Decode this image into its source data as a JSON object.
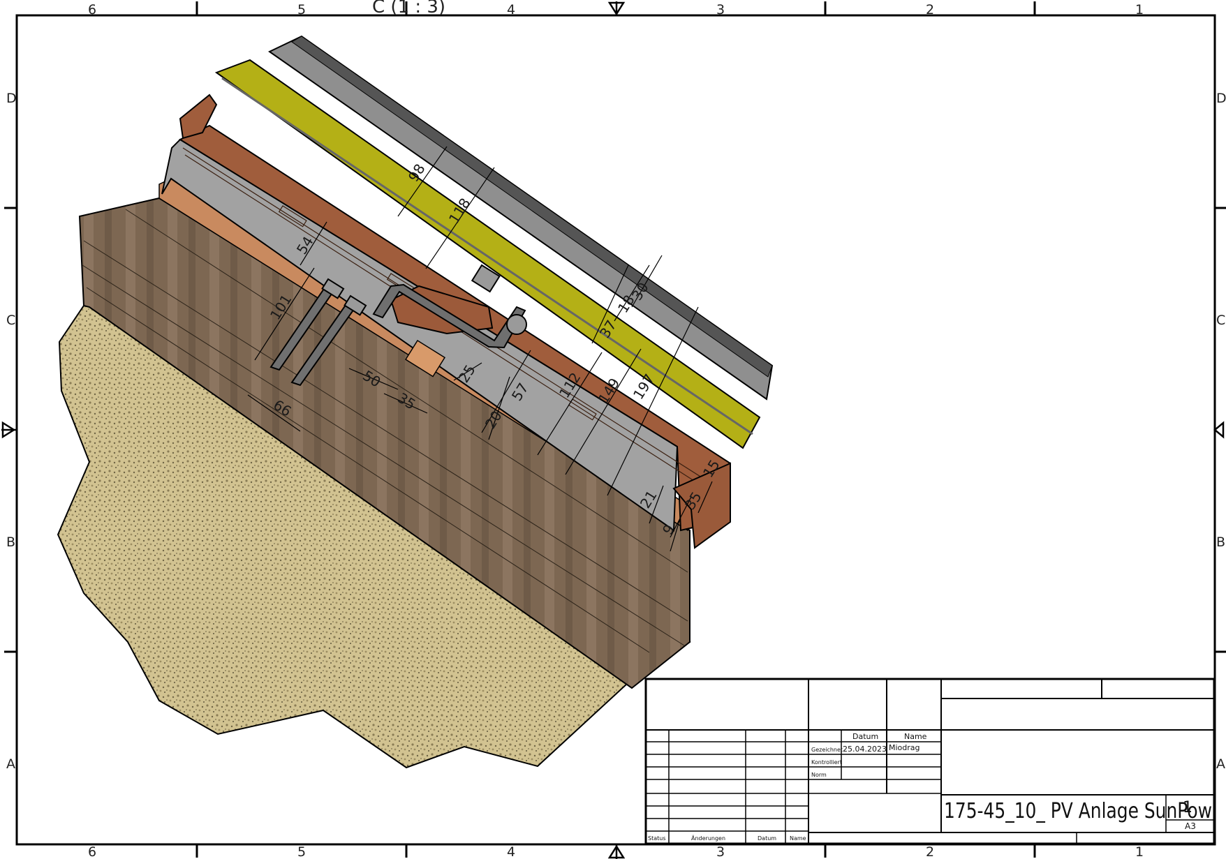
{
  "view_label": "C (1 : 3)",
  "zones": {
    "columns": [
      "6",
      "5",
      "4",
      "3",
      "2",
      "1"
    ],
    "rows": [
      "D",
      "C",
      "B",
      "A"
    ]
  },
  "dimensions": [
    "98",
    "118",
    "54",
    "101",
    "50",
    "35",
    "66",
    "25",
    "57",
    "20",
    "112",
    "149",
    "197",
    "37",
    "18",
    "30",
    "15",
    "21",
    "35",
    "9"
  ],
  "title_block": {
    "datum_header": "Datum",
    "name_header": "Name",
    "gezeichnet_label": "Gezeichnet",
    "gezeichnet_date": "25.04.2023",
    "gezeichnet_name": "Miodrag",
    "kontrolliert_label": "Kontrolliert",
    "norm_label": "Norm",
    "status_label": "Status",
    "aenderungen_label": "Änderungen",
    "datum_label": "Datum",
    "name_label": "Name",
    "title": "175-45_10_ PV Anlage SunPow",
    "sheet_number": "1",
    "format": "A3"
  },
  "colors": {
    "pv_module_gray": "#8f8f8f",
    "pv_frame_dark": "#555555",
    "yellow_layer": "#b5b214",
    "timber_brown": "#a0603e",
    "timber_light": "#c88a62",
    "insulation_gray": "#a3a3a3",
    "wood_wall": "#7f6a54",
    "gravel": "#cfbf8e"
  }
}
